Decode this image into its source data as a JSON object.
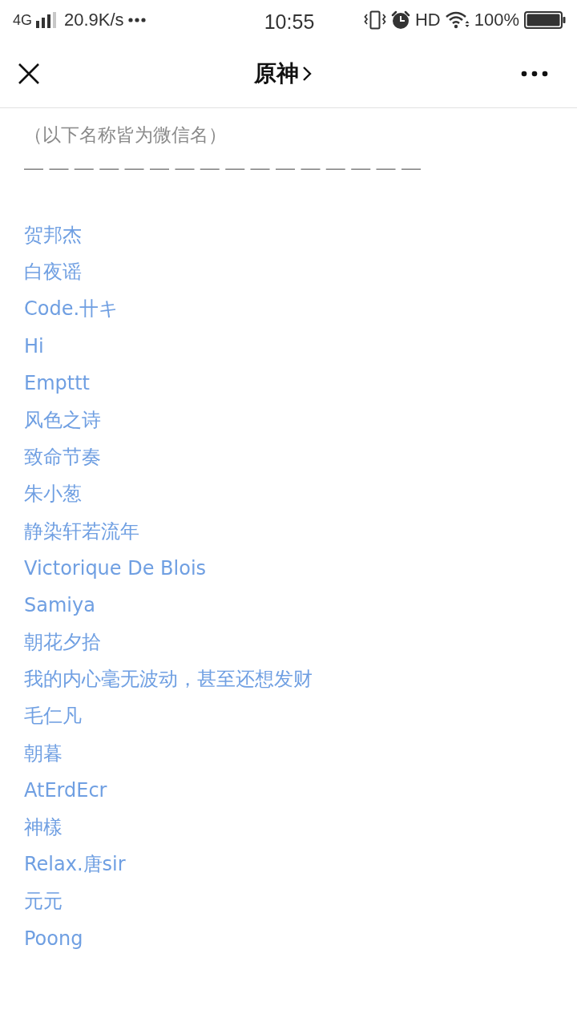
{
  "status_bar": {
    "network": "4G",
    "speed": "20.9K/s",
    "time": "10:55",
    "hd": "HD",
    "battery": "100%"
  },
  "nav": {
    "title": "原神"
  },
  "article": {
    "note": "（以下名称皆为微信名）",
    "divider": "————————————————",
    "names": [
      "贺邦杰",
      "白夜谣",
      "Code.卄キ",
      "Hi",
      "Empttt",
      "风色之诗",
      "致命节奏",
      "朱小葱",
      "静染轩若流年",
      "Victorique De Blois",
      "Samiya",
      "朝花夕拾",
      "我的内心毫无波动，甚至还想发财",
      "毛仁凡",
      "朝暮",
      "AtErdEcr",
      "神樣",
      "Relax.唐sir",
      "元元",
      "Poong"
    ]
  }
}
